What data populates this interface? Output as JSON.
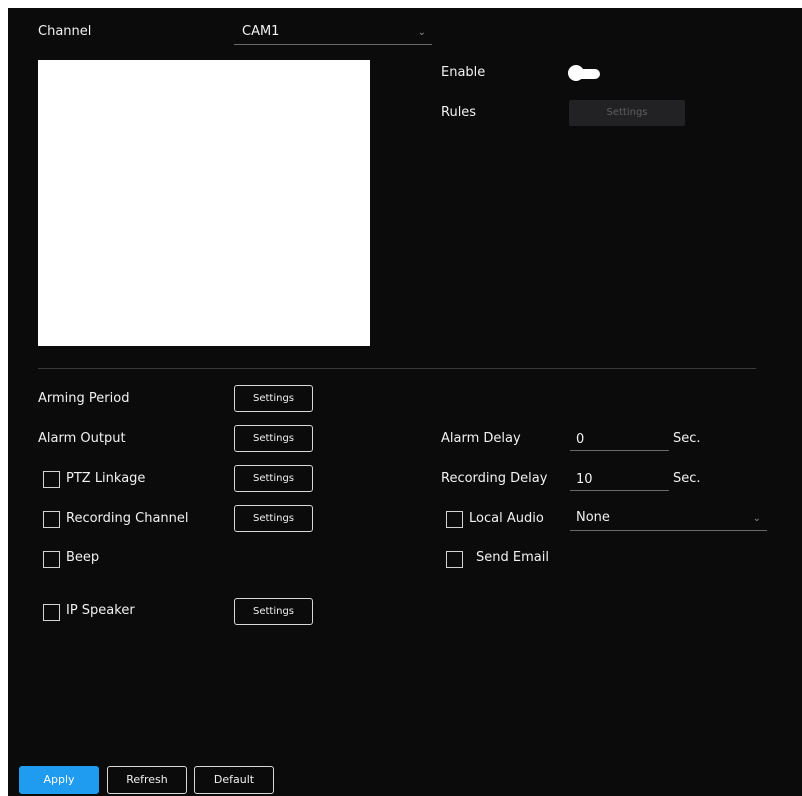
{
  "channel": {
    "label": "Channel",
    "value": "CAM1"
  },
  "enable": {
    "label": "Enable",
    "state": "on"
  },
  "rules": {
    "label": "Rules",
    "button": "Settings"
  },
  "left_rows": {
    "arming_period": {
      "label": "Arming Period",
      "button": "Settings"
    },
    "alarm_output": {
      "label": "Alarm Output",
      "button": "Settings"
    },
    "ptz_linkage": {
      "label": "PTZ Linkage",
      "button": "Settings",
      "checked": false
    },
    "recording_channel": {
      "label": "Recording Channel",
      "button": "Settings",
      "checked": false
    },
    "beep": {
      "label": "Beep",
      "checked": false
    },
    "ip_speaker": {
      "label": "IP Speaker",
      "button": "Settings",
      "checked": false
    }
  },
  "right_rows": {
    "alarm_delay": {
      "label": "Alarm Delay",
      "value": "0",
      "unit": "Sec."
    },
    "recording_delay": {
      "label": "Recording Delay",
      "value": "10",
      "unit": "Sec."
    },
    "local_audio": {
      "label": "Local Audio",
      "value": "None",
      "checked": false
    },
    "send_email": {
      "label": "Send Email",
      "checked": false
    }
  },
  "footer": {
    "apply": "Apply",
    "refresh": "Refresh",
    "default": "Default"
  },
  "colors": {
    "background": "#0b0b0c",
    "accent": "#1f9bf0",
    "text": "#f2f2f2"
  }
}
